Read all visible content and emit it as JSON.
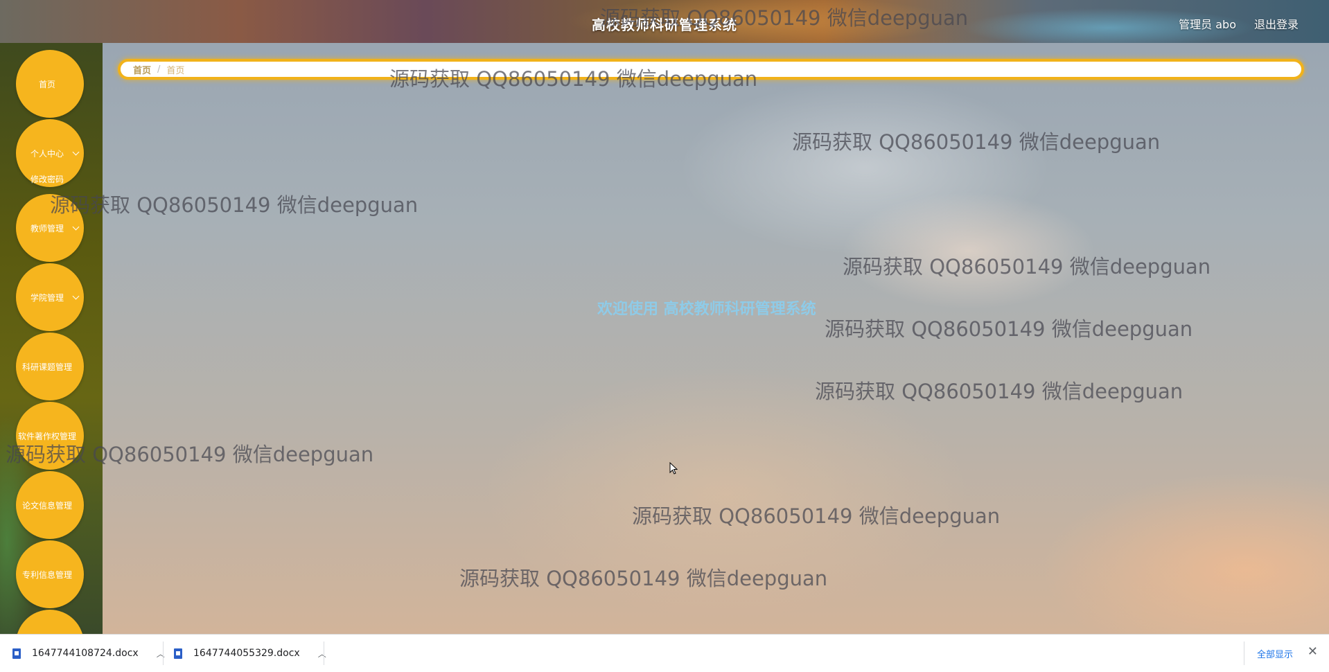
{
  "header": {
    "title": "高校教师科研管理系统",
    "user_label": "管理员 abo",
    "logout": "退出登录"
  },
  "sidebar": {
    "items": [
      {
        "label": "首页",
        "has_chevron": false
      },
      {
        "label": "个人中心",
        "has_chevron": true
      },
      {
        "label": "教师管理",
        "has_chevron": true
      },
      {
        "label": "学院管理",
        "has_chevron": true
      },
      {
        "label": "科研课题管理",
        "has_chevron": false
      },
      {
        "label": "软件著作权管理",
        "has_chevron": false
      },
      {
        "label": "论文信息管理",
        "has_chevron": false
      },
      {
        "label": "专利信息管理",
        "has_chevron": false
      }
    ],
    "submenu": {
      "label": "修改密码"
    }
  },
  "breadcrumb": {
    "home": "首页",
    "separator": "/",
    "current": "首页"
  },
  "main": {
    "welcome": "欢迎使用 高校教师科研管理系统"
  },
  "watermark": "源码获取 QQ86050149 微信deepguan",
  "downloads": {
    "files": [
      {
        "name": "1647744108724.docx",
        "icon": "word-file-icon"
      },
      {
        "name": "1647744055329.docx",
        "icon": "word-file-icon"
      }
    ],
    "show_all": "全部显示",
    "close_icon": "close-icon"
  },
  "colors": {
    "accent": "#f6b51e",
    "welcome": "#8ecbe8",
    "download_link": "#1a73e8"
  }
}
